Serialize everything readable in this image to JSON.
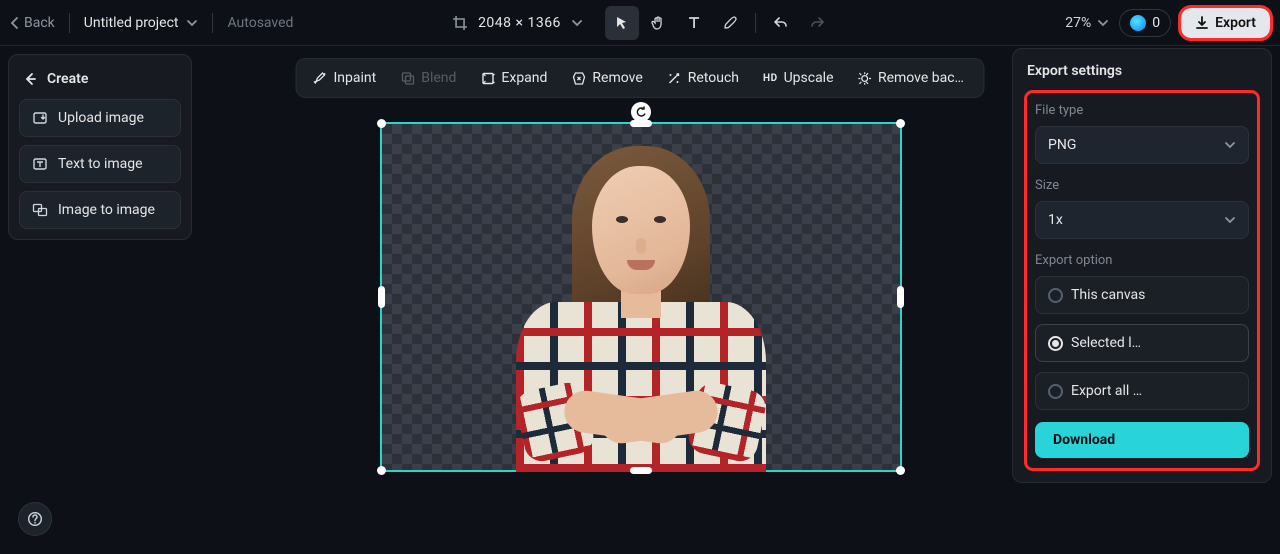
{
  "header": {
    "back_label": "Back",
    "project_name": "Untitled project",
    "save_status": "Autosaved",
    "dimensions": "2048 × 1366",
    "zoom": "27%",
    "credits": "0",
    "export_label": "Export"
  },
  "sidebar": {
    "create_label": "Create",
    "items": [
      {
        "label": "Upload image",
        "icon": "upload-image-icon"
      },
      {
        "label": "Text to image",
        "icon": "text-to-image-icon"
      },
      {
        "label": "Image to image",
        "icon": "image-to-image-icon"
      }
    ]
  },
  "action_bar": {
    "items": [
      {
        "label": "Inpaint",
        "icon": "inpaint-icon",
        "enabled": true
      },
      {
        "label": "Blend",
        "icon": "blend-icon",
        "enabled": false
      },
      {
        "label": "Expand",
        "icon": "expand-icon",
        "enabled": true
      },
      {
        "label": "Remove",
        "icon": "remove-icon",
        "enabled": true
      },
      {
        "label": "Retouch",
        "icon": "retouch-icon",
        "enabled": true
      },
      {
        "label": "Upscale",
        "icon": "upscale-icon",
        "enabled": true
      },
      {
        "label": "Remove back…",
        "icon": "remove-bg-icon",
        "enabled": true
      }
    ]
  },
  "export_panel": {
    "title": "Export settings",
    "file_type_label": "File type",
    "file_type_value": "PNG",
    "size_label": "Size",
    "size_value": "1x",
    "export_option_label": "Export option",
    "options": {
      "this_canvas": "This canvas",
      "selected_layer": "Selected l…",
      "export_all": "Export all …"
    },
    "selected_option": "selected_layer",
    "download_label": "Download"
  },
  "canvas": {
    "selection_color": "#2bd5c8",
    "subject": "person-plaid-shirt-arms-crossed"
  }
}
